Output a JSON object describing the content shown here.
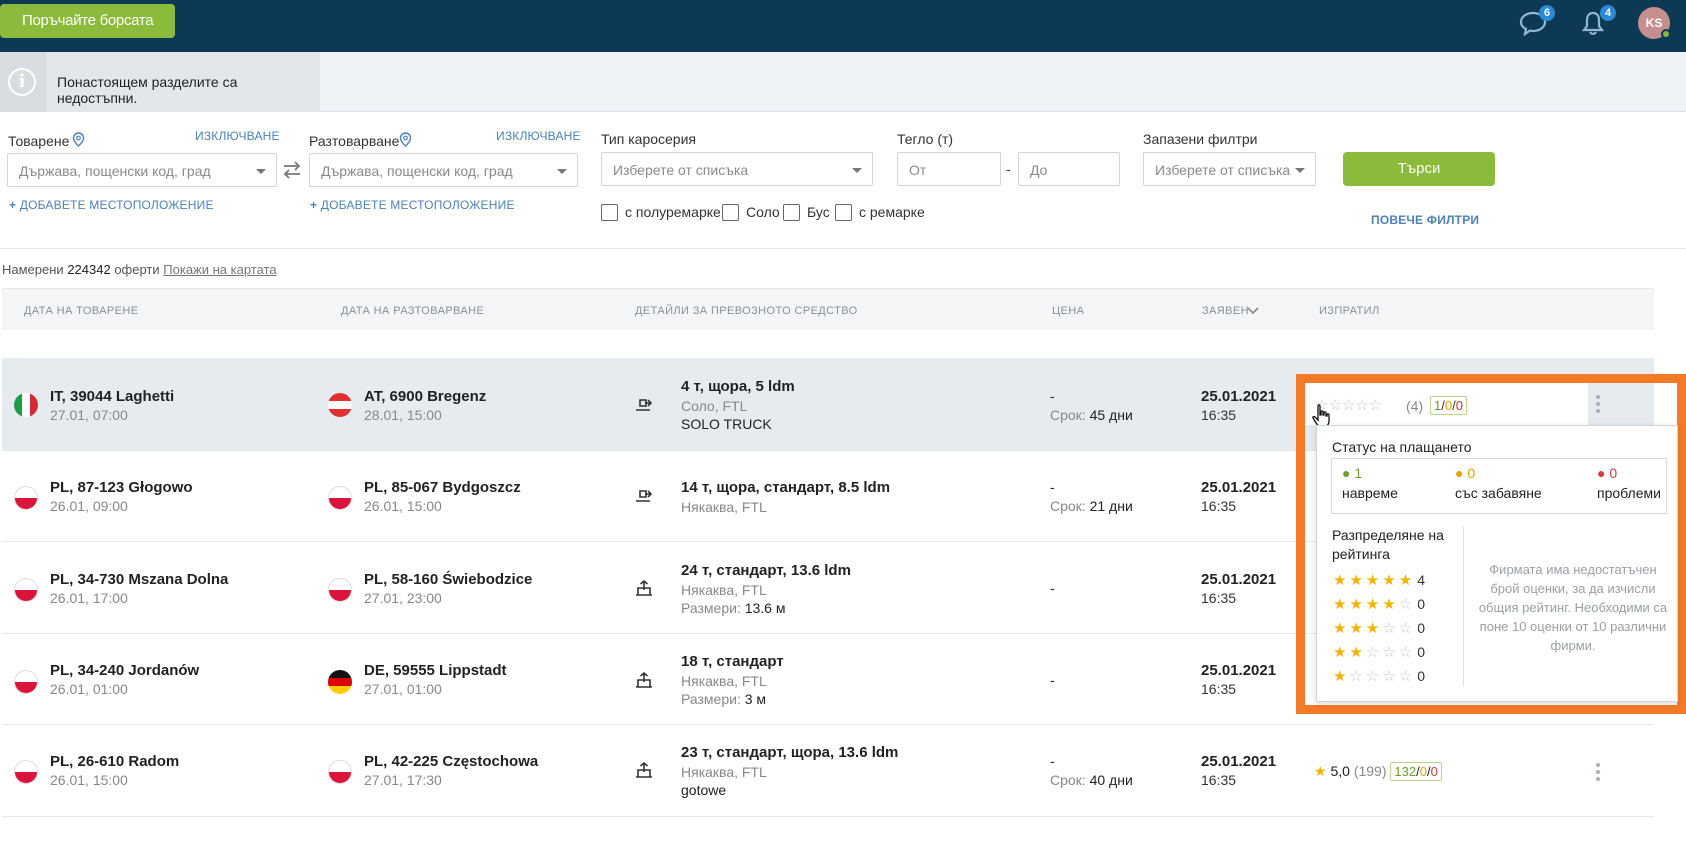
{
  "topbar": {
    "order_button": "Поръчайте борсата",
    "messages_count": "6",
    "notifications_count": "4",
    "avatar_initials": "KS"
  },
  "notice": {
    "text": "Понастоящем разделите са недостъпни."
  },
  "filters": {
    "loading": {
      "label": "Товарене",
      "exclude": "ИЗКЛЮЧВАНЕ",
      "placeholder": "Държава, пощенски код, град",
      "add_location": "ДОБАВЕТЕ МЕСТОПОЛОЖЕНИЕ"
    },
    "unloading": {
      "label": "Разтоварване",
      "exclude": "ИЗКЛЮЧВАНЕ",
      "placeholder": "Държава, пощенски код, град",
      "add_location": "ДОБАВЕТЕ МЕСТОПОЛОЖЕНИЕ"
    },
    "body_type": {
      "label": "Тип каросерия",
      "placeholder": "Изберете от списъка"
    },
    "weight": {
      "label": "Тегло (т)",
      "from": "От",
      "separator": "-",
      "to": "До"
    },
    "saved": {
      "label": "Запазени филтри",
      "placeholder": "Изберете от списъка"
    },
    "checkboxes": [
      "с полуремарке",
      "Соло",
      "Бус",
      "с ремарке"
    ],
    "search_button": "Търси",
    "more_filters": "ПОВЕЧЕ ФИЛТРИ"
  },
  "results": {
    "prefix": "Намерени",
    "count": "224342",
    "suffix": "оферти",
    "map_link": "Покажи на картата"
  },
  "table": {
    "headers": [
      "ДАТА НА ТОВАРЕНЕ",
      "ДАТА НА РАЗТОВАРВАНЕ",
      "ДЕТАЙЛИ ЗА ПРЕВОЗНОТО СРЕДСТВО",
      "ЦЕНА",
      "ЗАЯВЕН",
      "ИЗПРАТИЛ"
    ],
    "rows": [
      {
        "from_country": "IT",
        "from_city": "IT, 39044 Laghetti",
        "from_date": "27.01, 07:00",
        "to_country": "AT",
        "to_city": "AT, 6900 Bregenz",
        "to_date": "28.01, 15:00",
        "truck": "4 т, щора, 5 ldm",
        "truck_sub": "Соло, FTL",
        "truck_extra_label": "",
        "truck_extra": "SOLO TRUCK",
        "price": "-",
        "term_label": "Срок:",
        "term": "45 дни",
        "posted_date": "25.01.2021",
        "posted_time": "16:35",
        "rating_count": "(4)",
        "r_ok": "1",
        "r_late": "0",
        "r_bad": "0"
      },
      {
        "from_country": "PL",
        "from_city": "PL, 87-123 Głogowo",
        "from_date": "26.01, 09:00",
        "to_country": "PL",
        "to_city": "PL, 85-067 Bydgoszcz",
        "to_date": "26.01, 15:00",
        "truck": "14 т, щора, стандарт, 8.5 ldm",
        "truck_sub": "Някаква, FTL",
        "truck_extra_label": "",
        "truck_extra": "",
        "price": "-",
        "term_label": "Срок:",
        "term": "21 дни",
        "posted_date": "25.01.2021",
        "posted_time": "16:35"
      },
      {
        "from_country": "PL",
        "from_city": "PL, 34-730 Mszana Dolna",
        "from_date": "26.01, 17:00",
        "to_country": "PL",
        "to_city": "PL, 58-160 Świebodzice",
        "to_date": "27.01, 23:00",
        "truck": "24 т, стандарт, 13.6 ldm",
        "truck_sub": "Някаква, FTL",
        "truck_extra_label": "Размери:",
        "truck_extra": "13.6 м",
        "price": "-",
        "term_label": "",
        "term": "",
        "posted_date": "25.01.2021",
        "posted_time": "16:35"
      },
      {
        "from_country": "PL",
        "from_city": "PL, 34-240 Jordanów",
        "from_date": "26.01, 01:00",
        "to_country": "DE",
        "to_city": "DE, 59555 Lippstadt",
        "to_date": "27.01, 01:00",
        "truck": "18 т, стандарт",
        "truck_sub": "Някаква, FTL",
        "truck_extra_label": "Размери:",
        "truck_extra": "3 м",
        "price": "-",
        "term_label": "",
        "term": "",
        "posted_date": "25.01.2021",
        "posted_time": "16:35"
      },
      {
        "from_country": "PL",
        "from_city": "PL, 26-610 Radom",
        "from_date": "26.01, 15:00",
        "to_country": "PL",
        "to_city": "PL, 42-225 Częstochowa",
        "to_date": "27.01, 17:30",
        "truck": "23 т, стандарт, щора, 13.6 ldm",
        "truck_sub": "Някаква, FTL",
        "truck_extra_label": "",
        "truck_extra": "gotowe",
        "price": "-",
        "term_label": "Срок:",
        "term": "40 дни",
        "posted_date": "25.01.2021",
        "posted_time": "16:35",
        "rating_value": "5,0",
        "rating_count": "(199)",
        "r_ok": "132",
        "r_late": "0",
        "r_bad": "0"
      }
    ]
  },
  "popup": {
    "payment_title": "Статус на плащането",
    "on_time_count": "1",
    "on_time_label": "навреме",
    "late_count": "0",
    "late_label": "със забавяне",
    "problems_count": "0",
    "problems_label": "проблеми",
    "distribution_title": "Разпределяне на рейтинга",
    "distribution": [
      {
        "stars": 5,
        "count": "4"
      },
      {
        "stars": 4,
        "count": "0"
      },
      {
        "stars": 3,
        "count": "0"
      },
      {
        "stars": 2,
        "count": "0"
      },
      {
        "stars": 1,
        "count": "0"
      }
    ],
    "note": "Фирмата има недостатъчен брой оценки, за да изчисли общия рейтинг. Необходими са поне 10 оценки от 10 различни фирми."
  },
  "colors": {
    "topbar": "#0c3a55",
    "accent_green": "#8cbb3c",
    "highlight_orange": "#f47a28",
    "star_yellow": "#f0b400"
  }
}
